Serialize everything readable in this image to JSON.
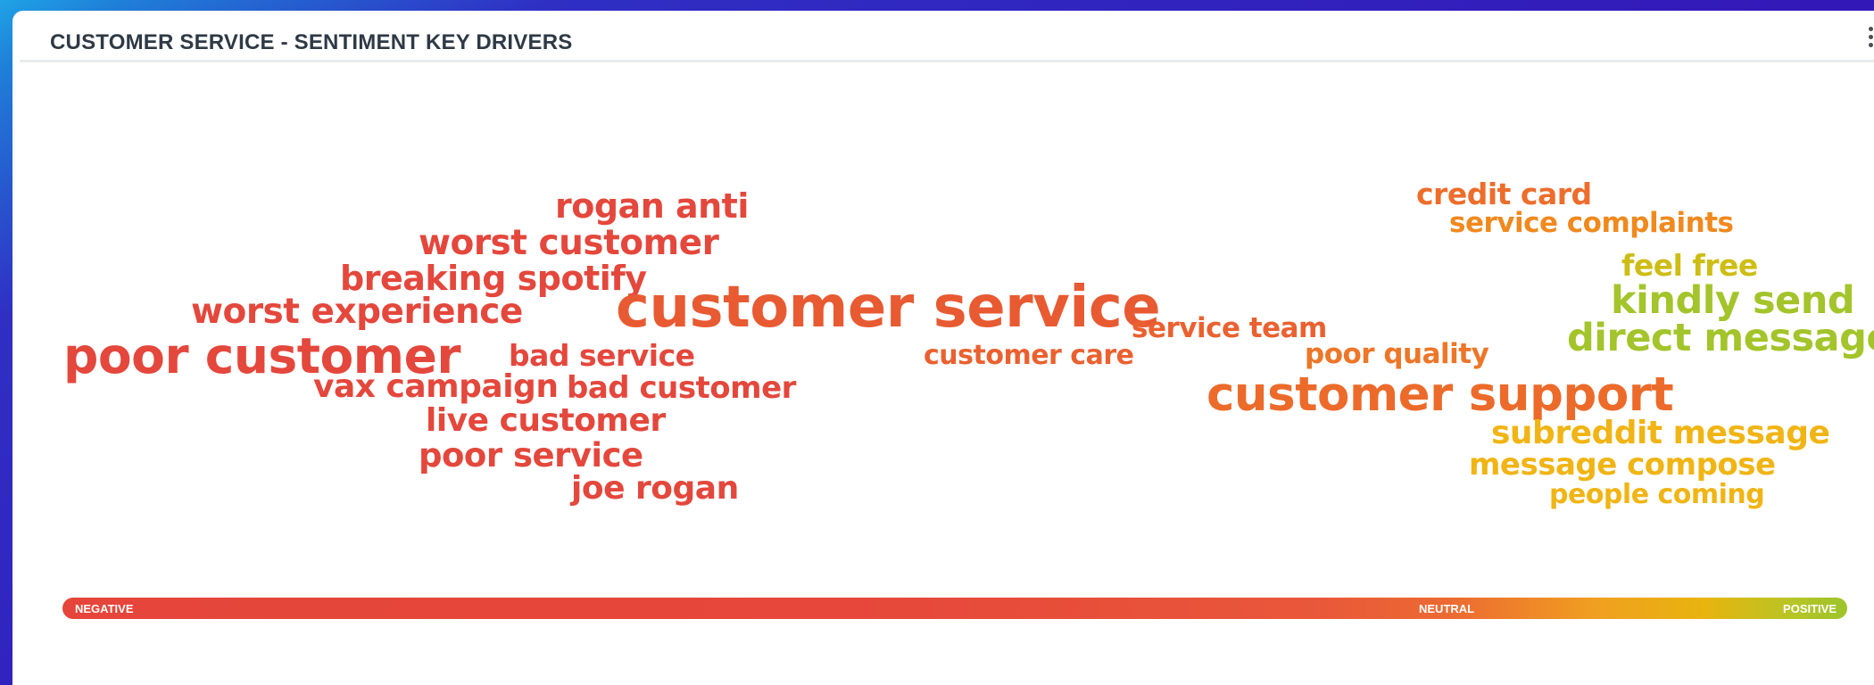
{
  "panel": {
    "title": "CUSTOMER SERVICE - SENTIMENT KEY DRIVERS"
  },
  "words": [
    {
      "text": "rogan anti",
      "color": "#e4473c"
    },
    {
      "text": "worst customer",
      "color": "#e4473c"
    },
    {
      "text": "breaking spotify",
      "color": "#e4473c"
    },
    {
      "text": "worst experience",
      "color": "#e4473c"
    },
    {
      "text": "poor customer",
      "color": "#e4473c"
    },
    {
      "text": "bad service",
      "color": "#e4473c"
    },
    {
      "text": "vax campaign",
      "color": "#e4473c"
    },
    {
      "text": "bad customer",
      "color": "#e4473c"
    },
    {
      "text": "live customer",
      "color": "#e4473c"
    },
    {
      "text": "poor service",
      "color": "#e4473c"
    },
    {
      "text": "joe rogan",
      "color": "#e4473c"
    },
    {
      "text": "customer service",
      "color": "#e85a32"
    },
    {
      "text": "customer care",
      "color": "#ea6130"
    },
    {
      "text": "service team",
      "color": "#ea6130"
    },
    {
      "text": "poor quality",
      "color": "#ed7628"
    },
    {
      "text": "customer support",
      "color": "#ec6b2a"
    },
    {
      "text": "credit card",
      "color": "#ed6d2b"
    },
    {
      "text": "service complaints",
      "color": "#f0891e"
    },
    {
      "text": "feel free",
      "color": "#cdbd14"
    },
    {
      "text": "kindly send",
      "color": "#a3c42a"
    },
    {
      "text": "direct message",
      "color": "#a3c42a"
    },
    {
      "text": "subreddit message",
      "color": "#f0b414"
    },
    {
      "text": "message compose",
      "color": "#f0b414"
    },
    {
      "text": "people coming",
      "color": "#f0b414"
    }
  ],
  "scale": {
    "negative": "NEGATIVE",
    "neutral": "NEUTRAL",
    "positive": "POSITIVE"
  }
}
